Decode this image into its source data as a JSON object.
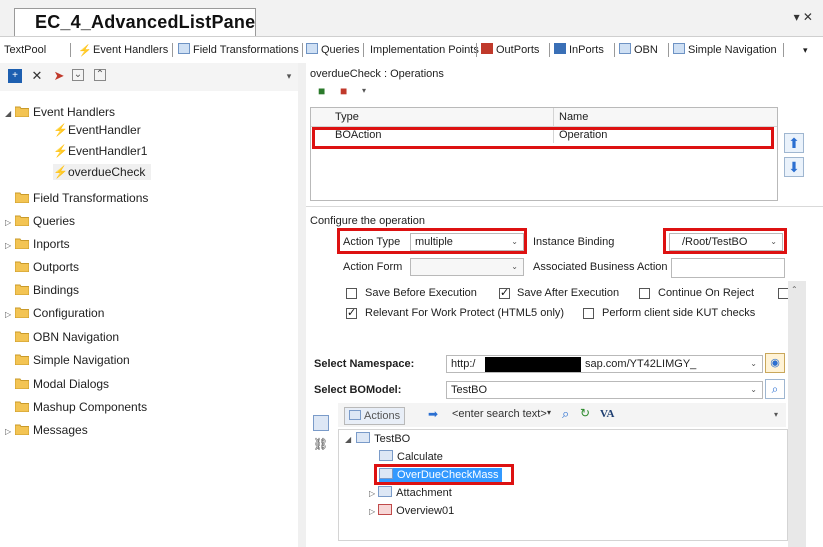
{
  "window": {
    "title": "EC_4_AdvancedListPane",
    "controls": "▾ ✕"
  },
  "tabs": [
    {
      "label": "TextPool"
    },
    {
      "label": "Event Handlers"
    },
    {
      "label": "Field Transformations"
    },
    {
      "label": "Queries"
    },
    {
      "label": "Implementation Points"
    },
    {
      "label": "OutPorts"
    },
    {
      "label": "InPorts"
    },
    {
      "label": "OBN"
    },
    {
      "label": "Simple Navigation"
    }
  ],
  "left_tree": {
    "event_handlers": "Event Handlers",
    "handlers": [
      "EventHandler",
      "EventHandler1",
      "overdueCheck"
    ],
    "folders": [
      "Field Transformations",
      "Queries",
      "Inports",
      "Outports",
      "Bindings",
      "Configuration",
      "OBN Navigation",
      "Simple Navigation",
      "Modal Dialogs",
      "Mashup Components",
      "Messages"
    ]
  },
  "operations": {
    "group_title": "overdueCheck : Operations",
    "col_type": "Type",
    "col_name": "Name",
    "row_type": "BOAction",
    "row_name": "Operation"
  },
  "config": {
    "group_title": "Configure the operation",
    "action_type_label": "Action Type",
    "action_type_value": "multiple",
    "instance_binding_label": "Instance Binding",
    "instance_binding_value": "/Root/TestBO",
    "action_form_label": "Action Form",
    "action_form_value": "",
    "associated_action_label": "Associated Business Action",
    "associated_action_value": "",
    "chk_save_before": "Save Before Execution",
    "chk_save_after": "Save After Execution",
    "chk_continue": "Continue On Reject",
    "chk_relevant": "Relevant For Work Protect (HTML5 only)",
    "chk_kut": "Perform client side KUT checks",
    "namespace_label": "Select Namespace:",
    "namespace_prefix": "http:/",
    "namespace_suffix": "sap.com/YT42LIMGY_",
    "bomodel_label": "Select BOModel:",
    "bomodel_value": "TestBO"
  },
  "bo_browser": {
    "actions_label": "Actions",
    "search_placeholder": "<enter search text>",
    "va": "VA",
    "root": "TestBO",
    "nodes": [
      "Calculate",
      "OverDueCheckMass",
      "Attachment",
      "Overview01"
    ]
  },
  "colors": {
    "highlight_red": "#d11111",
    "selection_blue": "#3399ff",
    "folder_yellow": "#f3c453"
  }
}
